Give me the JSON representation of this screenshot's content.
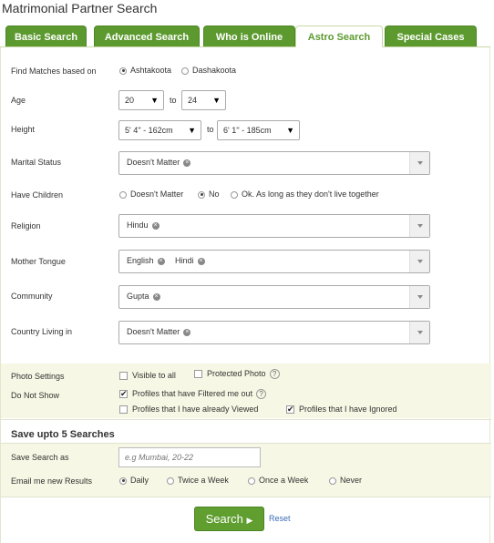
{
  "page_title": "Matrimonial Partner Search",
  "tabs": [
    {
      "label": "Basic Search",
      "active": false
    },
    {
      "label": "Advanced Search",
      "active": false
    },
    {
      "label": "Who is Online",
      "active": false
    },
    {
      "label": "Astro Search",
      "active": true
    },
    {
      "label": "Special Cases",
      "active": false
    }
  ],
  "find_matches": {
    "label": "Find Matches based on",
    "options": [
      "Ashtakoota",
      "Dashakoota"
    ],
    "selected": "Ashtakoota"
  },
  "age": {
    "label": "Age",
    "from": "20",
    "to_word": "to",
    "to": "24"
  },
  "height": {
    "label": "Height",
    "from": "5' 4'' - 162cm",
    "to_word": "to",
    "to": "6' 1'' - 185cm"
  },
  "marital_status": {
    "label": "Marital Status",
    "values": [
      "Doesn't Matter"
    ]
  },
  "have_children": {
    "label": "Have Children",
    "options": [
      "Doesn't Matter",
      "No",
      "Ok. As long as they don't live together"
    ],
    "selected": "No"
  },
  "religion": {
    "label": "Religion",
    "values": [
      "Hindu"
    ]
  },
  "mother_tongue": {
    "label": "Mother Tongue",
    "values": [
      "English",
      "Hindi"
    ]
  },
  "community": {
    "label": "Community",
    "values": [
      "Gupta"
    ]
  },
  "country": {
    "label": "Country Living in",
    "values": [
      "Doesn't Matter"
    ]
  },
  "photo_settings": {
    "label": "Photo Settings",
    "options": [
      {
        "label": "Visible to all",
        "checked": false
      },
      {
        "label": "Protected Photo",
        "checked": false
      }
    ]
  },
  "do_not_show": {
    "label": "Do Not Show",
    "options": [
      {
        "label": "Profiles that have Filtered me out",
        "checked": true
      },
      {
        "label": "Profiles that I have already Viewed",
        "checked": false
      },
      {
        "label": "Profiles that I have Ignored",
        "checked": true
      }
    ]
  },
  "help_glyph": "?",
  "save": {
    "heading": "Save upto 5 Searches",
    "save_as_label": "Save Search as",
    "placeholder": "e.g Mumbai, 20-22",
    "email_label": "Email me new Results",
    "email_options": [
      "Daily",
      "Twice a Week",
      "Once a Week",
      "Never"
    ],
    "email_selected": "Daily"
  },
  "buttons": {
    "search": "Search",
    "reset": "Reset"
  },
  "colors": {
    "tab_green": "#5c9a2f",
    "band": "#f6f7e4",
    "link": "#3b6cb8"
  }
}
